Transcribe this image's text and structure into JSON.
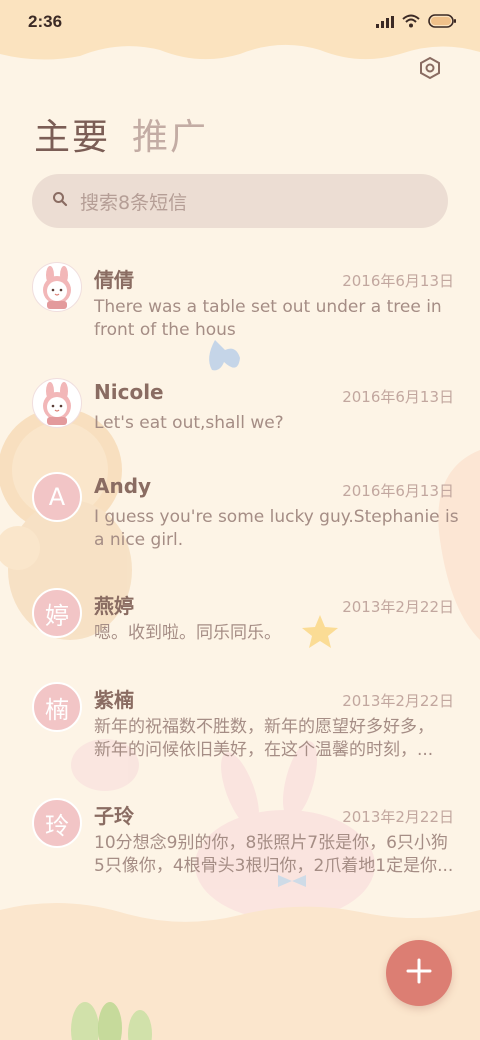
{
  "status_bar": {
    "time": "2:36"
  },
  "tabs": [
    {
      "label": "主要"
    },
    {
      "label": "推广"
    }
  ],
  "search": {
    "placeholder": "搜索8条短信"
  },
  "messages": [
    {
      "name": "倩倩",
      "date": "2016年6月13日",
      "text": "There was a table set out under a tree in front of the hous",
      "avatar": "bunny-avatar"
    },
    {
      "name": "Nicole",
      "date": "2016年6月13日",
      "text": "Let's eat out,shall we?",
      "avatar": "bunny-avatar"
    },
    {
      "name": "Andy",
      "date": "2016年6月13日",
      "text": "I guess you're some lucky guy.Stephanie is a nice girl.",
      "avatar_letter": "A"
    },
    {
      "name": "燕婷",
      "date": "2013年2月22日",
      "text": "嗯。收到啦。同乐同乐。",
      "avatar_letter": "婷"
    },
    {
      "name": "紫楠",
      "date": "2013年2月22日",
      "line1": "新年的祝福数不胜数，新年的愿望好多好多，",
      "line2": "新年的问候依旧美好，在这个温馨的时刻，...",
      "avatar_letter": "楠"
    },
    {
      "name": "子玲",
      "date": "2013年2月22日",
      "line1": "10分想念9别的你，8张照片7张是你，6只小狗",
      "line2": "5只像你，4根骨头3根归你，2爪着地1定是你...",
      "avatar_letter": "玲"
    }
  ],
  "fab": {
    "icon": "plus-icon"
  },
  "colors": {
    "background": "#fdf4e6",
    "accent": "#dc7e73",
    "avatar": "#f2c5c6"
  }
}
